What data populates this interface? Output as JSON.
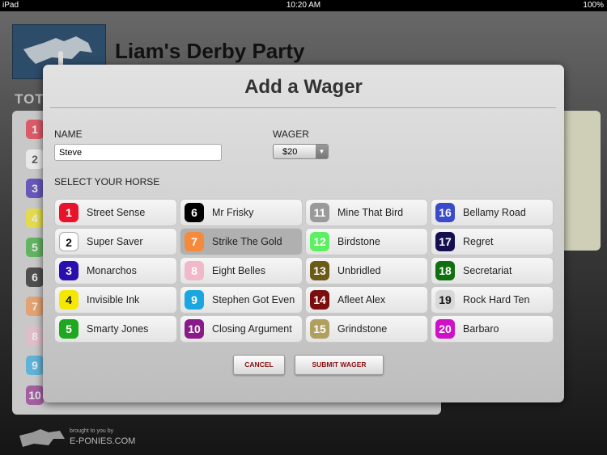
{
  "status_bar": {
    "device": "iPad",
    "time": "10:20 AM",
    "battery": "100%"
  },
  "app": {
    "title": "Liam's Derby Party",
    "section_label": "TOTE",
    "footer_by": "brought to you by",
    "footer_brand": "E-PONIES.COM"
  },
  "modal": {
    "title": "Add a Wager",
    "name_label": "NAME",
    "name_value": "Steve",
    "wager_label": "WAGER",
    "wager_value": "$20",
    "select_label": "SELECT YOUR HORSE",
    "selected_horse": "7",
    "horses": [
      {
        "num": "1",
        "name": "Street Sense",
        "color": "#e8122a"
      },
      {
        "num": "2",
        "name": "Super Saver",
        "color": "#ffffff"
      },
      {
        "num": "3",
        "name": "Monarchos",
        "color": "#2a0fb0"
      },
      {
        "num": "4",
        "name": "Invisible Ink",
        "color": "#f5e800"
      },
      {
        "num": "5",
        "name": "Smarty Jones",
        "color": "#1fa81f"
      },
      {
        "num": "6",
        "name": "Mr Frisky",
        "color": "#000000"
      },
      {
        "num": "7",
        "name": "Strike The Gold",
        "color": "#f58a3a"
      },
      {
        "num": "8",
        "name": "Eight Belles",
        "color": "#f0b8c8"
      },
      {
        "num": "9",
        "name": "Stephen Got Even",
        "color": "#1aa6e0"
      },
      {
        "num": "10",
        "name": "Closing Argument",
        "color": "#8a1a8a"
      },
      {
        "num": "11",
        "name": "Mine That Bird",
        "color": "#9a9a9a"
      },
      {
        "num": "12",
        "name": "Birdstone",
        "color": "#5cf060"
      },
      {
        "num": "13",
        "name": "Unbridled",
        "color": "#6b5a18"
      },
      {
        "num": "14",
        "name": "Afleet Alex",
        "color": "#7a0e0e"
      },
      {
        "num": "15",
        "name": "Grindstone",
        "color": "#b0a060"
      },
      {
        "num": "16",
        "name": "Bellamy Road",
        "color": "#3a4ac8"
      },
      {
        "num": "17",
        "name": "Regret",
        "color": "#141050"
      },
      {
        "num": "18",
        "name": "Secretariat",
        "color": "#107010"
      },
      {
        "num": "19",
        "name": "Rock Hard Ten",
        "color": "#d8d8d8"
      },
      {
        "num": "20",
        "name": "Barbaro",
        "color": "#d010c8"
      }
    ],
    "cancel_label": "CANCEL",
    "submit_label": "SUBMIT WAGER"
  }
}
